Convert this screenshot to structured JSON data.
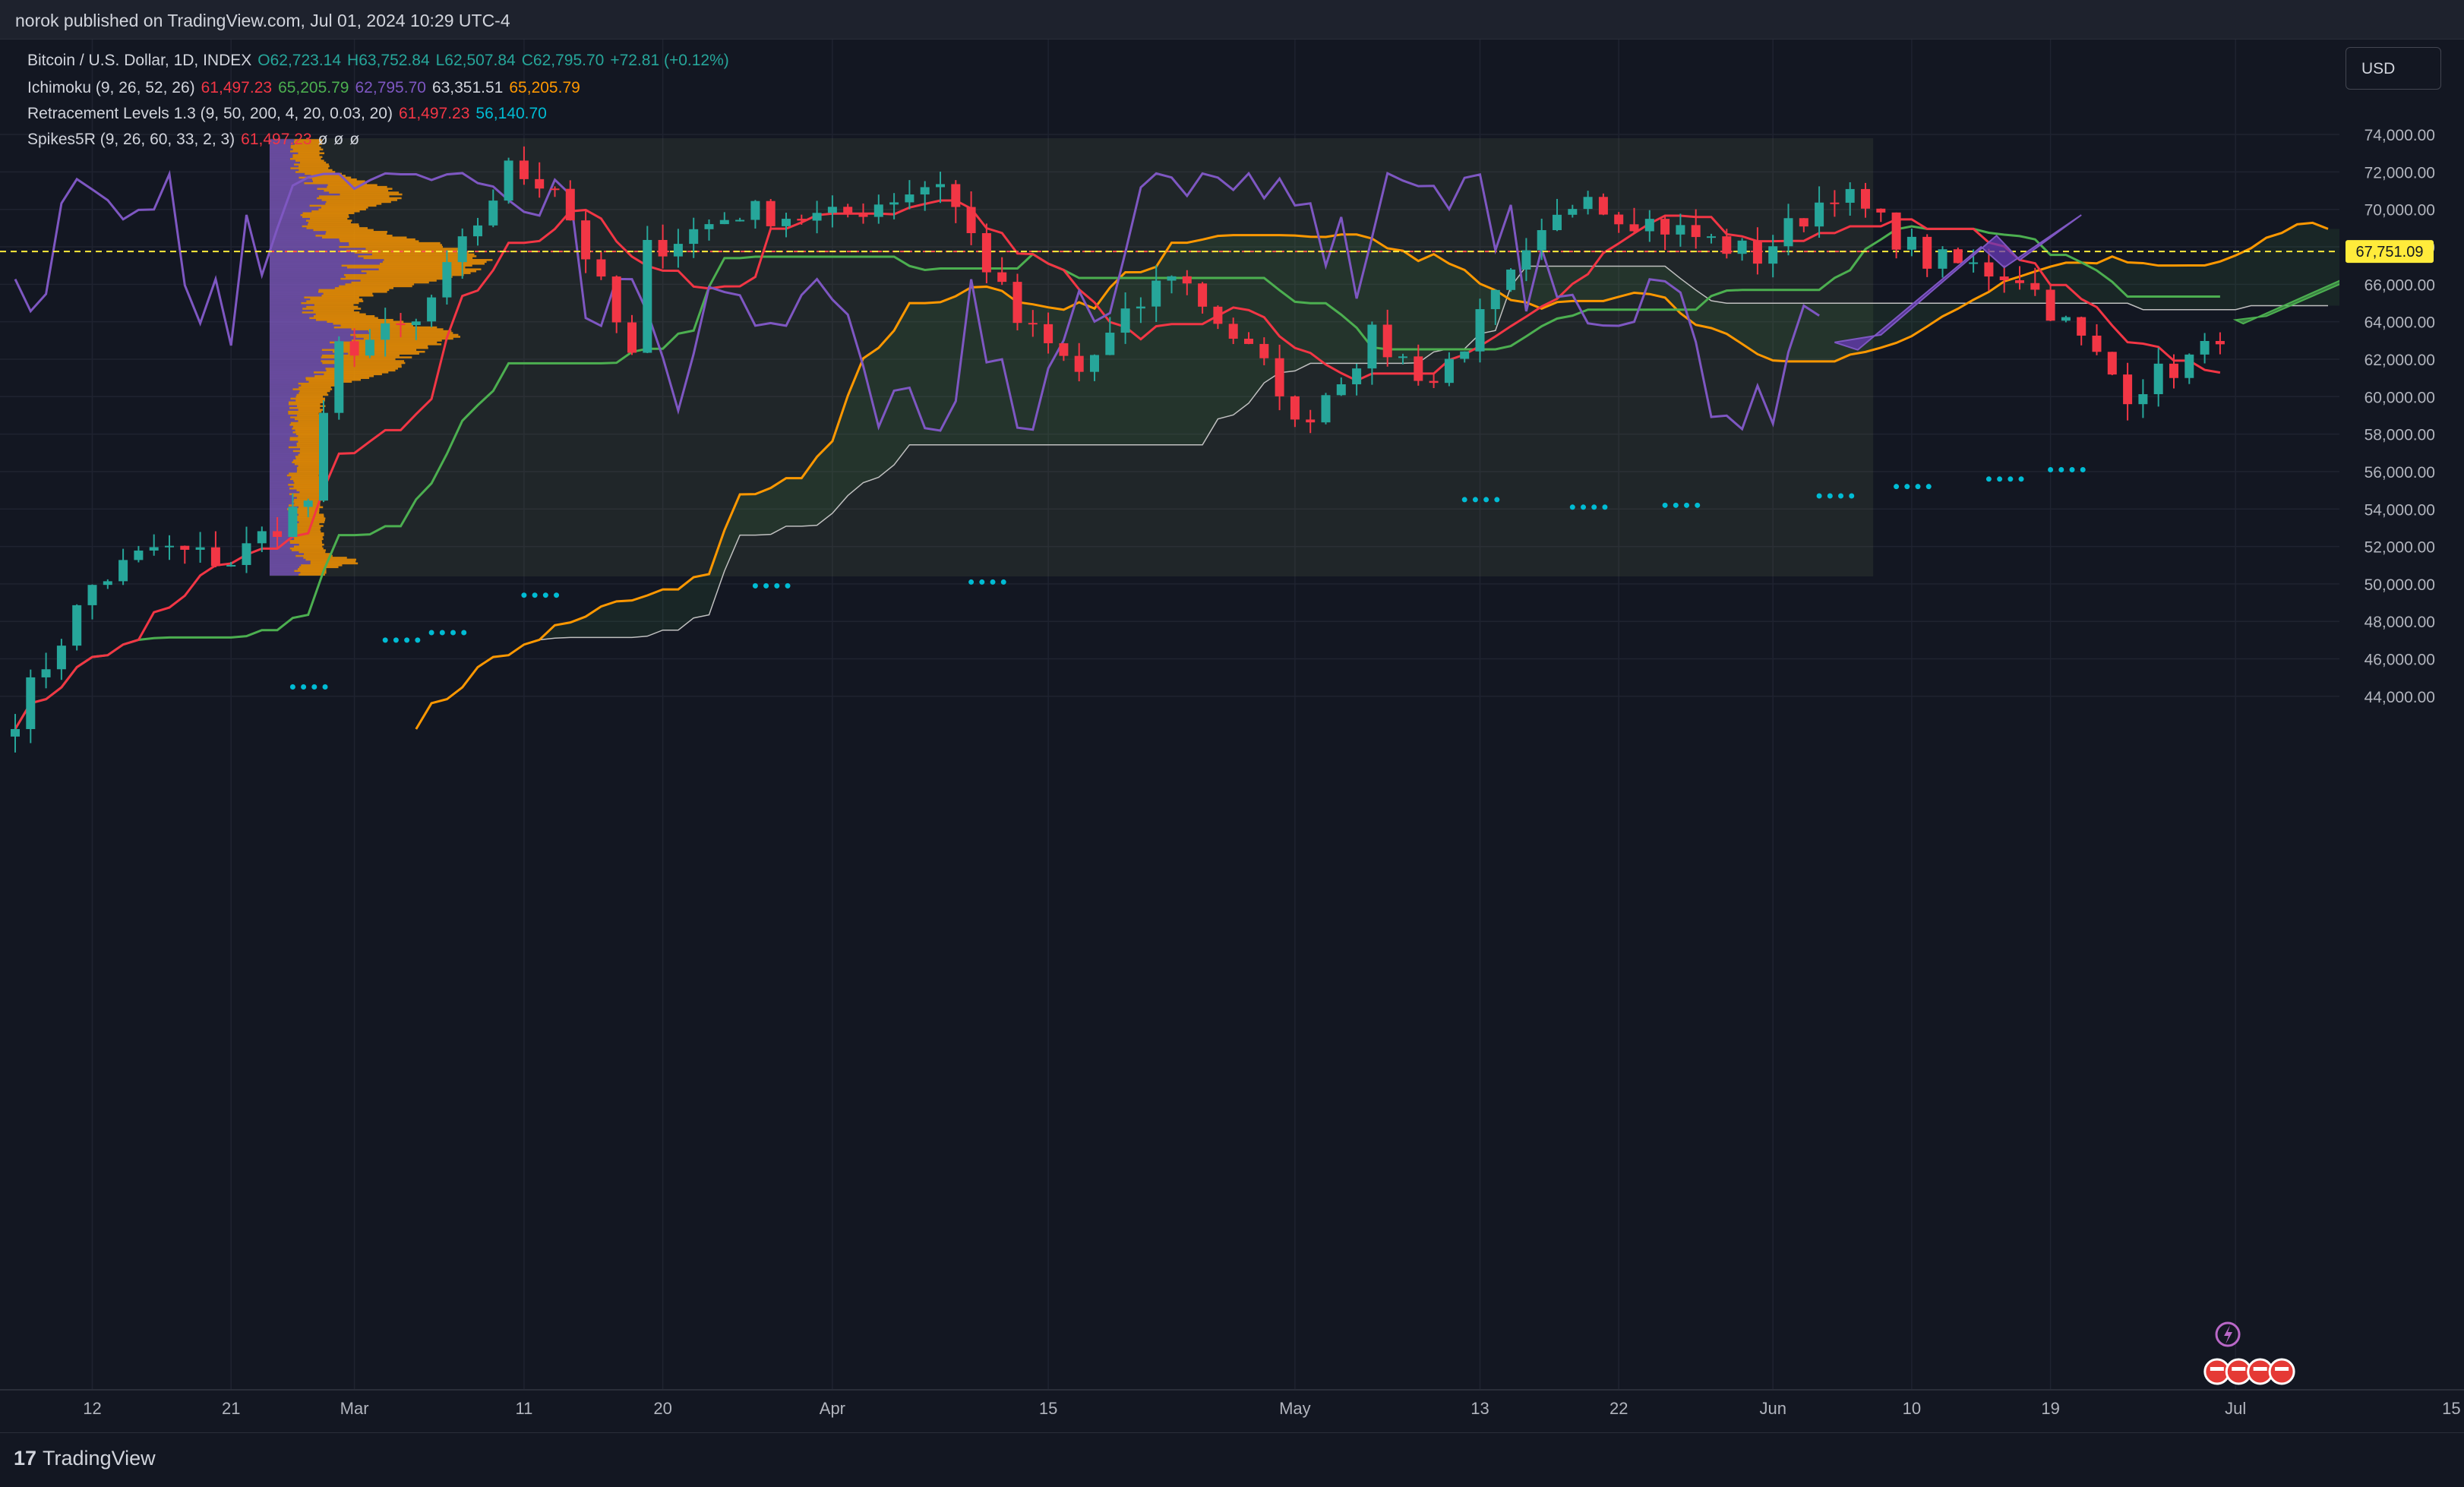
{
  "header": {
    "publisher": "norok published on TradingView.com, Jul 01, 2024 10:29 UTC-4"
  },
  "legend": {
    "symbol": {
      "name": "Bitcoin / U.S. Dollar, 1D, INDEX",
      "o": "O62,723.14",
      "h": "H63,752.84",
      "l": "L62,507.84",
      "c": "C62,795.70",
      "chg": "+72.81 (+0.12%)"
    },
    "ichimoku": {
      "name": "Ichimoku (9, 26, 52, 26)",
      "v1": "61,497.23",
      "v2": "65,205.79",
      "v3": "62,795.70",
      "v4": "63,351.51",
      "v5": "65,205.79"
    },
    "retracement": {
      "name": "Retracement Levels 1.3 (9, 50, 200, 4, 20, 0.03, 20)",
      "v1": "61,497.23",
      "v2": "56,140.70"
    },
    "spikes": {
      "name": "Spikes5R (9, 26, 60, 33, 2, 3)",
      "v1": "61,497.23",
      "v2": "ø",
      "v3": "ø",
      "v4": "ø"
    }
  },
  "currency_button": "USD",
  "footer": {
    "brand": "TradingView",
    "logo": "17"
  },
  "colors": {
    "up": "#26a69a",
    "down": "#f23645",
    "tenkan": "#f23645",
    "kijun": "#4caf50",
    "chikou": "#7e57c2",
    "lagging": "#c0c0c0",
    "orange": "#ff9800",
    "dots": "#00bcd4",
    "price_tag": "#ffeb3b"
  },
  "chart_data": {
    "type": "candlestick",
    "symbol": "Bitcoin / U.S. Dollar, 1D, INDEX",
    "ylim": [
      42600,
      76000
    ],
    "y_ticks": [
      "44,000.00",
      "46,000.00",
      "48,000.00",
      "50,000.00",
      "52,000.00",
      "54,000.00",
      "56,000.00",
      "58,000.00",
      "60,000.00",
      "62,000.00",
      "64,000.00",
      "66,000.00",
      "68,000.00",
      "70,000.00",
      "72,000.00",
      "74,000.00"
    ],
    "x_ticks": [
      "12",
      "21",
      "Mar",
      "11",
      "20",
      "Apr",
      "15",
      "May",
      "13",
      "22",
      "Jun",
      "10",
      "19",
      "Jul",
      "15"
    ],
    "current_price_label": "67,751.09",
    "current_price": 67751.09,
    "ohlc_keypoints": [
      [
        "Feb 7",
        43000
      ],
      [
        "Feb 12",
        49900
      ],
      [
        "Feb 16",
        51900
      ],
      [
        "Feb 21",
        51200
      ],
      [
        "Feb 26",
        54500
      ],
      [
        "Feb 28",
        62500
      ],
      [
        "Mar 5",
        63800
      ],
      [
        "Mar 11",
        72100
      ],
      [
        "Mar 14",
        71400
      ],
      [
        "Mar 19",
        62000
      ],
      [
        "Mar 20",
        67800
      ],
      [
        "Mar 26",
        69900
      ],
      [
        "Apr 1",
        69500
      ],
      [
        "Apr 8",
        71600
      ],
      [
        "Apr 13",
        64000
      ],
      [
        "Apr 17",
        61300
      ],
      [
        "Apr 23",
        66800
      ],
      [
        "Apr 30",
        60600
      ],
      [
        "May 1",
        58300
      ],
      [
        "May 6",
        63100
      ],
      [
        "May 10",
        60800
      ],
      [
        "May 15",
        66200
      ],
      [
        "May 20",
        71400
      ],
      [
        "May 21",
        70100
      ],
      [
        "May 31",
        67500
      ],
      [
        "Jun 5",
        71100
      ],
      [
        "Jun 11",
        67300
      ],
      [
        "Jun 17",
        66500
      ],
      [
        "Jun 24",
        60300
      ],
      [
        "Jun 30",
        62800
      ]
    ],
    "series": [
      {
        "name": "Ichimoku (9, 26, 52, 26)"
      },
      {
        "name": "Retracement Levels 1.3 (9, 50, 200, 4, 20, 0.03, 20)"
      },
      {
        "name": "Spikes5R (9, 26, 60, 33, 2, 3)"
      }
    ],
    "spikes_dots": [
      [
        "Feb 25",
        44500
      ],
      [
        "Mar 3",
        47000
      ],
      [
        "Mar 6",
        47400
      ],
      [
        "Mar 12",
        49400
      ],
      [
        "Mar 27",
        49900
      ],
      [
        "Apr 10",
        50100
      ],
      [
        "May 12",
        54500
      ],
      [
        "May 19",
        54100
      ],
      [
        "May 25",
        54200
      ],
      [
        "Jun 4",
        54700
      ],
      [
        "Jun 9",
        55200
      ],
      [
        "Jun 15",
        55600
      ],
      [
        "Jun 19",
        56100
      ]
    ]
  }
}
